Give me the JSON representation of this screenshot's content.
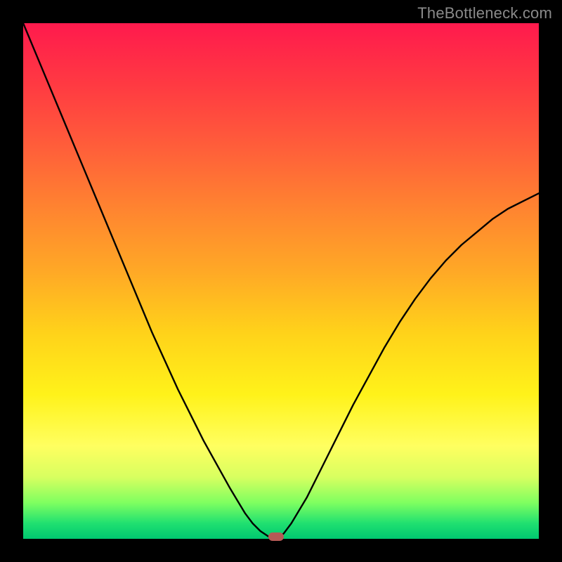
{
  "watermark": "TheBottleneck.com",
  "chart_data": {
    "type": "line",
    "title": "",
    "xlabel": "",
    "ylabel": "",
    "xlim": [
      0,
      100
    ],
    "ylim": [
      0,
      100
    ],
    "grid": false,
    "legend": false,
    "background_gradient": {
      "top_color": "#ff1a4d",
      "bottom_color": "#00c870",
      "stops": [
        {
          "pos": 0.0,
          "color": "#ff1a4d"
        },
        {
          "pos": 0.5,
          "color": "#ffa826"
        },
        {
          "pos": 0.8,
          "color": "#ffff60"
        },
        {
          "pos": 1.0,
          "color": "#00c870"
        }
      ]
    },
    "series": [
      {
        "name": "bottleneck-curve",
        "color": "#000000",
        "x": [
          0.0,
          2.5,
          5.0,
          7.5,
          10.0,
          12.5,
          15.0,
          17.5,
          20.0,
          22.5,
          25.0,
          27.5,
          30.0,
          32.5,
          35.0,
          37.5,
          40.0,
          41.5,
          43.0,
          44.5,
          46.0,
          47.5,
          49.0,
          50.5,
          52.0,
          55.0,
          58.0,
          61.0,
          64.0,
          67.0,
          70.0,
          73.0,
          76.0,
          79.0,
          82.0,
          85.0,
          88.0,
          91.0,
          94.0,
          97.0,
          100.0
        ],
        "y": [
          100.0,
          94.0,
          88.0,
          82.0,
          76.0,
          70.0,
          64.0,
          58.0,
          52.0,
          46.0,
          40.0,
          34.5,
          29.0,
          24.0,
          19.0,
          14.5,
          10.0,
          7.5,
          5.0,
          3.0,
          1.5,
          0.5,
          0.0,
          1.0,
          3.0,
          8.0,
          14.0,
          20.0,
          26.0,
          31.5,
          37.0,
          42.0,
          46.5,
          50.5,
          54.0,
          57.0,
          59.5,
          62.0,
          64.0,
          65.5,
          67.0
        ]
      }
    ],
    "marker": {
      "x": 49.0,
      "y": 0.0,
      "color": "#b65a56",
      "shape": "rounded-rect"
    }
  }
}
